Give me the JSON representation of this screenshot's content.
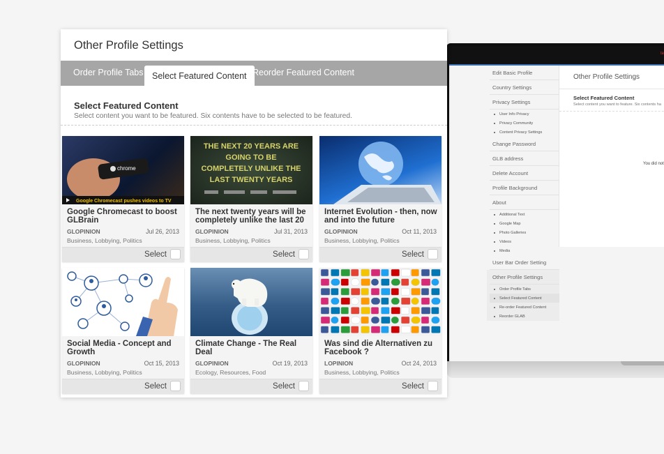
{
  "panel": {
    "title": "Other Profile Settings",
    "tabs": [
      {
        "label": "Order Profile Tabs",
        "active": false
      },
      {
        "label": "Select Featured Content",
        "active": true
      },
      {
        "label": "Reorder Featured Content",
        "active": false
      }
    ],
    "section_title": "Select Featured Content",
    "section_desc": "Select content you want to be featured. Six contents have to be selected to be featured.",
    "select_label": "Select",
    "cards": [
      {
        "title": "Google Chromecast to boost GLBrain",
        "author": "GLOPINION",
        "date": "Jul 26, 2013",
        "tags": "Business, Lobbying, Politics",
        "thumb_text": "chrome",
        "thumb_caption": "Google Chromecast pushes videos to TV"
      },
      {
        "title": "The next twenty years will be completely unlike the last 20",
        "author": "GLOPINION",
        "date": "Jul 31, 2013",
        "tags": "Business, Lobbying, Politics",
        "thumb_lines": [
          "THE NEXT 20 YEARS ARE",
          "GOING TO BE",
          "COMPLETELY UNLIKE THE",
          "LAST TWENTY YEARS"
        ]
      },
      {
        "title": "Internet Evolution - then, now and into the future",
        "author": "GLOPINION",
        "date": "Oct 11, 2013",
        "tags": "Business, Lobbying, Politics"
      },
      {
        "title": "Social Media - Concept and Growth",
        "author": "GLOPINION",
        "date": "Oct 15, 2013",
        "tags": "Business, Lobbying, Politics"
      },
      {
        "title": "Climate Change - The Real Deal",
        "author": "GLOPINION",
        "date": "Oct 19, 2013",
        "tags": "Ecology, Resources, Food"
      },
      {
        "title": "Was sind die Alternativen zu Facebook ?",
        "author": "LOPINION",
        "date": "Oct 24, 2013",
        "tags": "Business, Lobbying, Politics"
      }
    ]
  },
  "laptop": {
    "sidebar": [
      {
        "label": "Edit Basic Profile",
        "sub": []
      },
      {
        "label": "Country Settings",
        "sub": []
      },
      {
        "label": "Privacy Settings",
        "sub": [
          "User Info Privacy",
          "Privacy Community",
          "Content Privacy Settings"
        ]
      },
      {
        "label": "Change Password",
        "sub": []
      },
      {
        "label": "GLB address",
        "sub": []
      },
      {
        "label": "Delete Account",
        "sub": []
      },
      {
        "label": "Profile Background",
        "sub": []
      },
      {
        "label": "About",
        "sub": [
          "Additional Text",
          "Google Map",
          "Photo Galleries",
          "Videos",
          "Media"
        ]
      },
      {
        "label": "User Bar Order Setting",
        "sub": []
      },
      {
        "label": "Other Profile Settings",
        "sub": [
          "Order Profile Tabs",
          "Select Featured Content",
          "Re-order Featured Content",
          "Reorder GLAB"
        ],
        "active": true,
        "active_sub": 1
      }
    ],
    "panel_title": "Other Profile Settings",
    "panel_sub": "Select Featured Content",
    "panel_desc": "Select content you want to feature. Six contents ha",
    "panel_note": "You did not"
  },
  "colors": {
    "tab_bar": "#a6a6a6",
    "accent_blue": "#3a6fb0"
  }
}
